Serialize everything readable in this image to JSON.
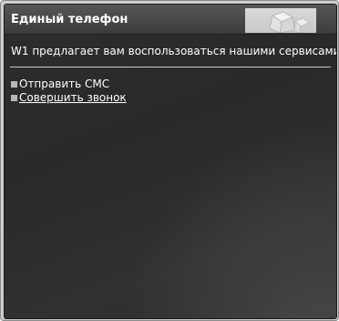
{
  "window": {
    "title": "Единый телефон"
  },
  "content": {
    "intro": "W1 предлагает вам воспользоваться нашими сервисами",
    "links": [
      {
        "label": "Отправить СМС",
        "underlined": false
      },
      {
        "label": "Совершить звонок",
        "underlined": true
      }
    ]
  },
  "icons": {
    "header_art": "cube-logo-icon",
    "bullet": "square-bullet-icon"
  },
  "colors": {
    "panel_background": "#2c2b2b",
    "titlebar": "#4a4a4a",
    "text": "#ffffff",
    "bullet": "#b8b8b8"
  }
}
